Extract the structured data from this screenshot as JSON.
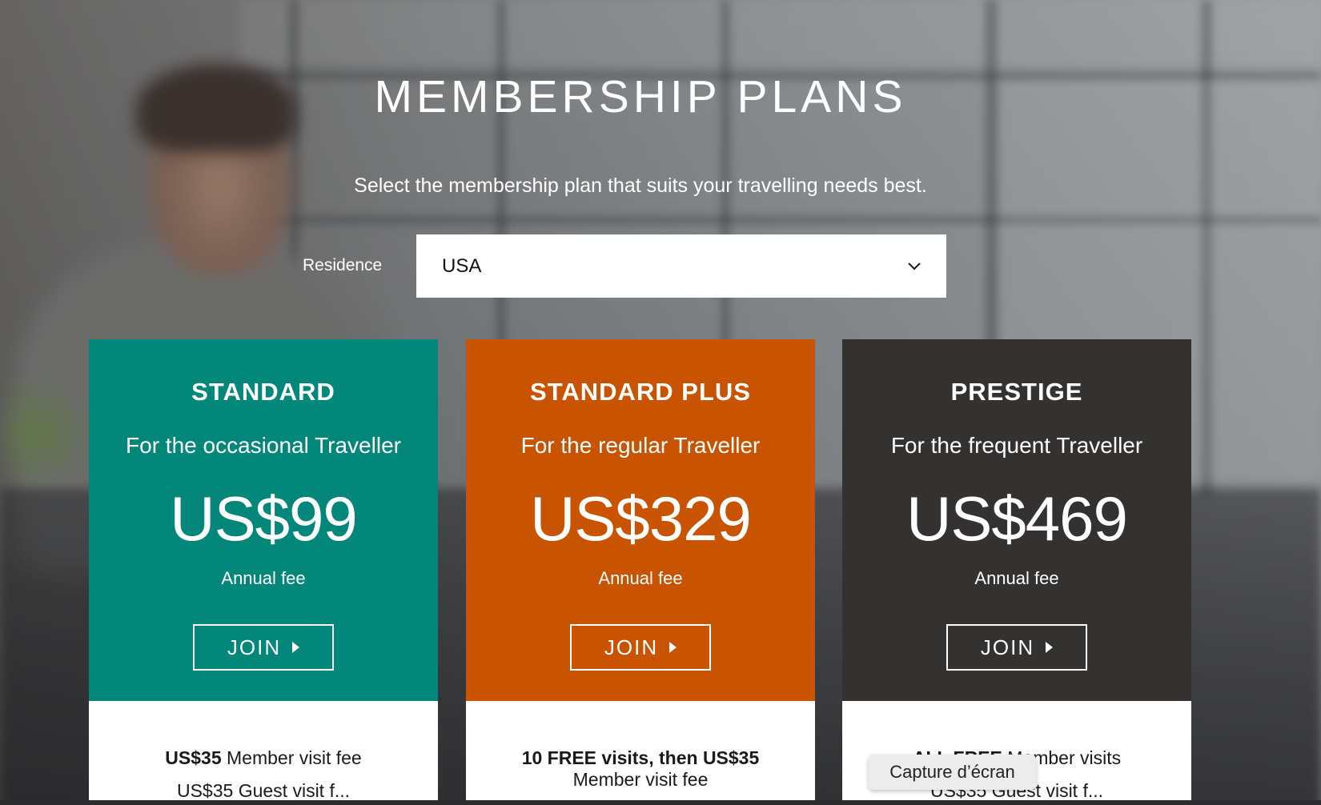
{
  "header": {
    "title": "MEMBERSHIP PLANS",
    "subtitle": "Select the membership plan that suits your travelling needs best."
  },
  "residence": {
    "label": "Residence",
    "selected": "USA"
  },
  "plans": [
    {
      "name": "STANDARD",
      "tagline": "For the occasional Traveller",
      "price": "US$99",
      "fee_label": "Annual fee",
      "join_label": "JOIN",
      "feature_bold": "US$35",
      "feature_rest": " Member visit fee",
      "feature_cut": "US$35 Guest visit f..."
    },
    {
      "name": "STANDARD PLUS",
      "tagline": "For the regular Traveller",
      "price": "US$329",
      "fee_label": "Annual fee",
      "join_label": "JOIN",
      "feature_bold": "10 FREE visits, then US$35",
      "feature_rest": "Member visit fee",
      "feature_cut": ""
    },
    {
      "name": "PRESTIGE",
      "tagline": "For the frequent Traveller",
      "price": "US$469",
      "fee_label": "Annual fee",
      "join_label": "JOIN",
      "feature_bold": "ALL FREE",
      "feature_rest": " Member visits",
      "feature_cut": "US$35 Guest visit f..."
    }
  ],
  "tooltip": "Capture d’écran",
  "colors": {
    "standard": "#03877a",
    "standard_plus": "#c85300",
    "prestige": "#343231"
  }
}
